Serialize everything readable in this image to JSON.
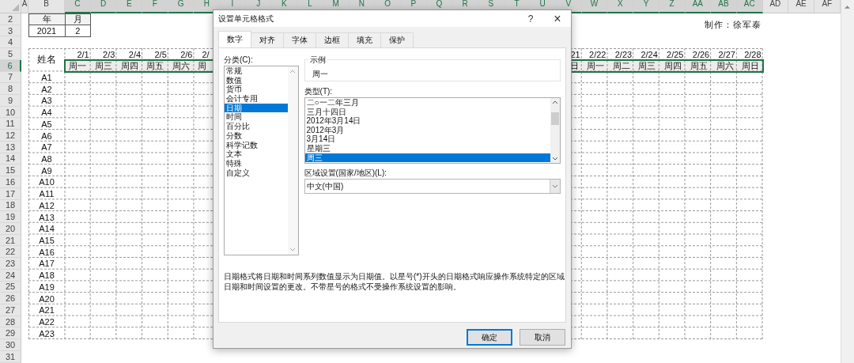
{
  "sheet": {
    "columns": [
      {
        "label": "A",
        "selected": false
      },
      {
        "label": "B",
        "selected": false
      },
      {
        "label": "C",
        "selected": true
      },
      {
        "label": "D",
        "selected": true
      },
      {
        "label": "E",
        "selected": true
      },
      {
        "label": "F",
        "selected": true
      },
      {
        "label": "G",
        "selected": true
      },
      {
        "label": "H",
        "selected": true
      },
      {
        "label": "I",
        "selected": true
      },
      {
        "label": "J",
        "selected": true
      },
      {
        "label": "K",
        "selected": true
      },
      {
        "label": "L",
        "selected": true
      },
      {
        "label": "M",
        "selected": true
      },
      {
        "label": "N",
        "selected": true
      },
      {
        "label": "O",
        "selected": true
      },
      {
        "label": "P",
        "selected": true
      },
      {
        "label": "Q",
        "selected": true
      },
      {
        "label": "R",
        "selected": true
      },
      {
        "label": "S",
        "selected": true
      },
      {
        "label": "T",
        "selected": true
      },
      {
        "label": "U",
        "selected": true
      },
      {
        "label": "V",
        "selected": true
      },
      {
        "label": "W",
        "selected": true
      },
      {
        "label": "X",
        "selected": true
      },
      {
        "label": "Y",
        "selected": true
      },
      {
        "label": "Z",
        "selected": true
      },
      {
        "label": "AA",
        "selected": true
      },
      {
        "label": "AB",
        "selected": true
      },
      {
        "label": "AC",
        "selected": true
      },
      {
        "label": "AD",
        "selected": false
      },
      {
        "label": "AE",
        "selected": false
      },
      {
        "label": "AF",
        "selected": false
      }
    ],
    "rows": [
      {
        "label": "2",
        "selected": false
      },
      {
        "label": "3",
        "selected": false
      },
      {
        "label": "4",
        "selected": false
      },
      {
        "label": "5",
        "selected": false
      },
      {
        "label": "6",
        "selected": true
      },
      {
        "label": "7",
        "selected": false
      },
      {
        "label": "8",
        "selected": false
      },
      {
        "label": "9",
        "selected": false
      },
      {
        "label": "10",
        "selected": false
      },
      {
        "label": "11",
        "selected": false
      },
      {
        "label": "12",
        "selected": false
      },
      {
        "label": "13",
        "selected": false
      },
      {
        "label": "14",
        "selected": false
      },
      {
        "label": "15",
        "selected": false
      },
      {
        "label": "16",
        "selected": false
      },
      {
        "label": "17",
        "selected": false
      },
      {
        "label": "18",
        "selected": false
      },
      {
        "label": "19",
        "selected": false
      },
      {
        "label": "20",
        "selected": false
      },
      {
        "label": "21",
        "selected": false
      },
      {
        "label": "22",
        "selected": false
      },
      {
        "label": "23",
        "selected": false
      },
      {
        "label": "24",
        "selected": false
      },
      {
        "label": "25",
        "selected": false
      },
      {
        "label": "26",
        "selected": false
      },
      {
        "label": "27",
        "selected": false
      },
      {
        "label": "28",
        "selected": false
      },
      {
        "label": "29",
        "selected": false
      },
      {
        "label": "30",
        "selected": false
      },
      {
        "label": "31",
        "selected": false
      }
    ],
    "year_month": {
      "headers": [
        "年",
        "月"
      ],
      "values": [
        "2021",
        "2"
      ]
    },
    "author": "制作：徐军泰",
    "name_header": "姓名",
    "left_days": [
      {
        "date": "2/1",
        "weekday": "周一",
        "cut_off": false
      },
      {
        "date": "2/3",
        "weekday": "周三",
        "cut_off": false
      },
      {
        "date": "2/4",
        "weekday": "周四",
        "cut_off": false
      },
      {
        "date": "2/5",
        "weekday": "周五",
        "cut_off": false
      },
      {
        "date": "2/6",
        "weekday": "周六",
        "cut_off": false
      },
      {
        "date": "2/",
        "weekday": "周",
        "cut_off": true
      }
    ],
    "right_days": [
      {
        "date": "21",
        "weekday": "日"
      },
      {
        "date": "2/22",
        "weekday": "周一"
      },
      {
        "date": "2/23",
        "weekday": "周二"
      },
      {
        "date": "2/24",
        "weekday": "周三"
      },
      {
        "date": "2/25",
        "weekday": "周四"
      },
      {
        "date": "2/26",
        "weekday": "周五"
      },
      {
        "date": "2/27",
        "weekday": "周六"
      },
      {
        "date": "2/28",
        "weekday": "周日"
      }
    ],
    "names": [
      "A1",
      "A2",
      "A3",
      "A4",
      "A5",
      "A6",
      "A7",
      "A8",
      "A9",
      "A10",
      "A11",
      "A12",
      "A13",
      "A14",
      "A15",
      "A16",
      "A17",
      "A18",
      "A19",
      "A20",
      "A21",
      "A22",
      "A23"
    ]
  },
  "dialog": {
    "title": "设置单元格格式",
    "help": "?",
    "close": "×",
    "tabs": [
      {
        "label": "数字",
        "selected": true
      },
      {
        "label": "对齐",
        "selected": false
      },
      {
        "label": "字体",
        "selected": false
      },
      {
        "label": "边框",
        "selected": false
      },
      {
        "label": "填充",
        "selected": false
      },
      {
        "label": "保护",
        "selected": false
      }
    ],
    "category_label": "分类(C):",
    "categories": [
      {
        "label": "常规",
        "selected": false
      },
      {
        "label": "数值",
        "selected": false
      },
      {
        "label": "货币",
        "selected": false
      },
      {
        "label": "会计专用",
        "selected": false
      },
      {
        "label": "日期",
        "selected": true
      },
      {
        "label": "时间",
        "selected": false
      },
      {
        "label": "百分比",
        "selected": false
      },
      {
        "label": "分数",
        "selected": false
      },
      {
        "label": "科学记数",
        "selected": false
      },
      {
        "label": "文本",
        "selected": false
      },
      {
        "label": "特殊",
        "selected": false
      },
      {
        "label": "自定义",
        "selected": false
      }
    ],
    "sample": {
      "label": "示例",
      "value": "周一"
    },
    "type_label": "类型(T):",
    "types": [
      {
        "label": "二○一二年三月",
        "selected": false
      },
      {
        "label": "三月十四日",
        "selected": false
      },
      {
        "label": "2012年3月14日",
        "selected": false
      },
      {
        "label": "2012年3月",
        "selected": false
      },
      {
        "label": "3月14日",
        "selected": false
      },
      {
        "label": "星期三",
        "selected": false
      },
      {
        "label": "周三",
        "selected": true
      }
    ],
    "locale_label": "区域设置(国家/地区)(L):",
    "locale": "中文(中国)",
    "description": "日期格式将日期和时间系列数值显示为日期值。以星号(*)开头的日期格式响应操作系统特定的区域日期和时间设置的更改。不带星号的格式不受操作系统设置的影响。",
    "buttons": [
      {
        "label": "确定",
        "kind": "default"
      },
      {
        "label": "取消",
        "kind": "normal"
      }
    ]
  }
}
